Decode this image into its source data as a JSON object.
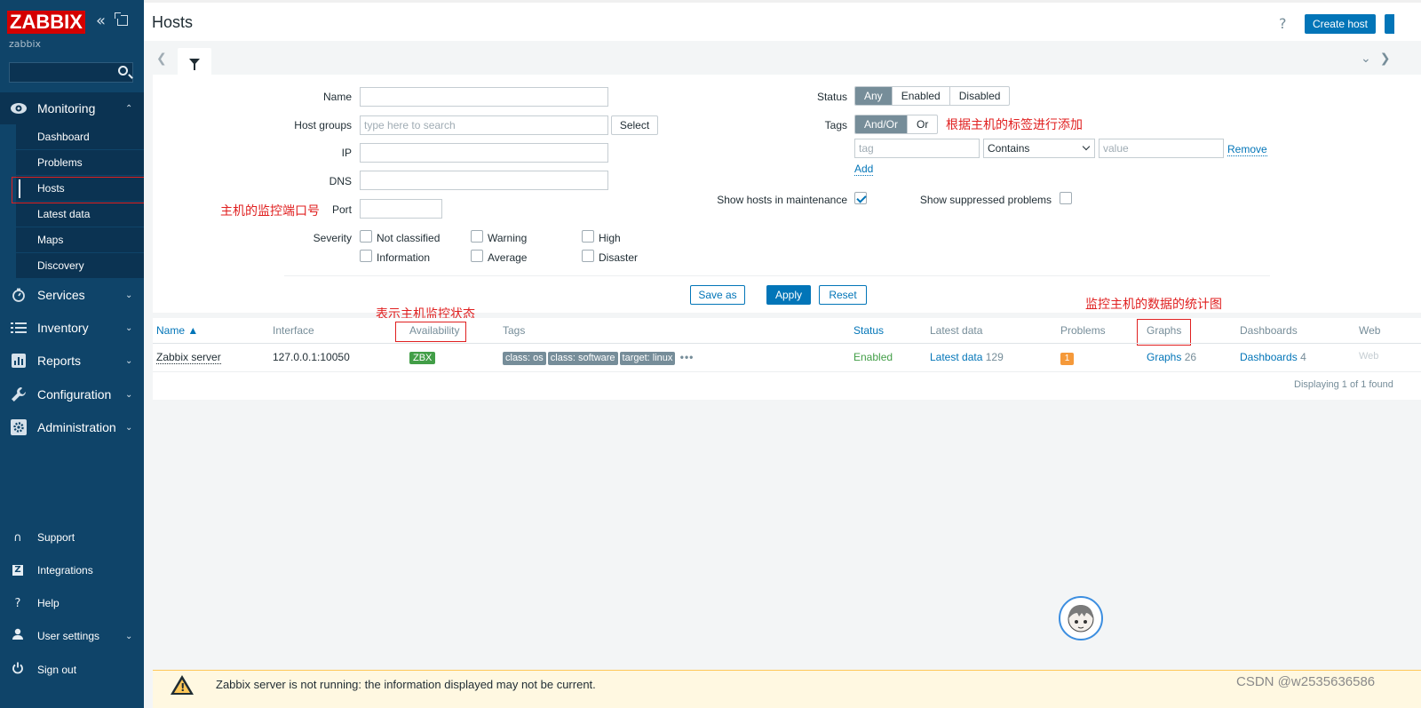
{
  "brand": {
    "logo": "ZABBIX",
    "server_name": "zabbix"
  },
  "sidebar": {
    "menu": [
      {
        "label": "Monitoring",
        "icon": "eye-icon",
        "chevron": "⌃"
      },
      {
        "label": "Services",
        "icon": "stopwatch-icon",
        "chevron": "⌄"
      },
      {
        "label": "Inventory",
        "icon": "list-icon",
        "chevron": "⌄"
      },
      {
        "label": "Reports",
        "icon": "bar-chart-icon",
        "chevron": "⌄"
      },
      {
        "label": "Configuration",
        "icon": "wrench-icon",
        "chevron": "⌄"
      },
      {
        "label": "Administration",
        "icon": "gear-icon",
        "chevron": "⌄"
      }
    ],
    "submenu": [
      "Dashboard",
      "Problems",
      "Hosts",
      "Latest data",
      "Maps",
      "Discovery"
    ],
    "selected_submenu": "Hosts",
    "bottom": [
      {
        "label": "Support",
        "icon": "headset-icon",
        "glyph": "∩"
      },
      {
        "label": "Integrations",
        "icon": "zabbix-z-icon",
        "glyph": "Z"
      },
      {
        "label": "Help",
        "icon": "question-icon",
        "glyph": "?"
      },
      {
        "label": "User settings",
        "icon": "user-icon",
        "glyph": "👤"
      },
      {
        "label": "Sign out",
        "icon": "power-icon",
        "glyph": "⏻"
      }
    ]
  },
  "header": {
    "title": "Hosts",
    "help": "?",
    "create_label": "Create host"
  },
  "filter": {
    "name_label": "Name",
    "host_groups_label": "Host groups",
    "host_groups_placeholder": "type here to search",
    "select_label": "Select",
    "ip_label": "IP",
    "dns_label": "DNS",
    "port_label": "Port",
    "severity_label": "Severity",
    "severities": [
      "Not classified",
      "Warning",
      "High",
      "Information",
      "Average",
      "Disaster"
    ],
    "status_label": "Status",
    "status_options": [
      "Any",
      "Enabled",
      "Disabled"
    ],
    "status_selected": "Any",
    "tags_label": "Tags",
    "tags_options": [
      "And/Or",
      "Or"
    ],
    "tags_selected": "And/Or",
    "tag_placeholder": "tag",
    "operator_value": "Contains",
    "value_placeholder": "value",
    "remove_label": "Remove",
    "add_label": "Add",
    "maintenance_label": "Show hosts in maintenance",
    "maintenance_checked": true,
    "suppressed_label": "Show suppressed problems",
    "suppressed_checked": false,
    "save_as": "Save as",
    "apply": "Apply",
    "reset": "Reset"
  },
  "annotations": {
    "port_note": "主机的监控端口号",
    "tags_note": "根据主机的标签进行添加",
    "availability_note": "表示主机监控状态",
    "graphs_note": "监控主机的数据的统计图"
  },
  "table": {
    "columns": [
      "Name ▲",
      "Interface",
      "Availability",
      "Tags",
      "Status",
      "Latest data",
      "Problems",
      "Graphs",
      "Dashboards",
      "Web"
    ],
    "rows": [
      {
        "name": "Zabbix server",
        "interface": "127.0.0.1:10050",
        "availability": "ZBX",
        "tags": [
          "class: os",
          "class: software",
          "target: linux"
        ],
        "tags_more": "•••",
        "status": "Enabled",
        "latest_data": "Latest data",
        "latest_count": "129",
        "problems": "1",
        "graphs": "Graphs",
        "graphs_count": "26",
        "dashboards": "Dashboards",
        "dashboards_count": "4",
        "web": "Web"
      }
    ],
    "displaying": "Displaying 1 of 1 found"
  },
  "warning": {
    "text": "Zabbix server is not running: the information displayed may not be current."
  },
  "watermark": "CSDN @w2535636586",
  "colors": {
    "sidebar": "#0f4469",
    "accent": "#0275b8",
    "annotation": "#e02020",
    "warning": "#ffc859"
  }
}
